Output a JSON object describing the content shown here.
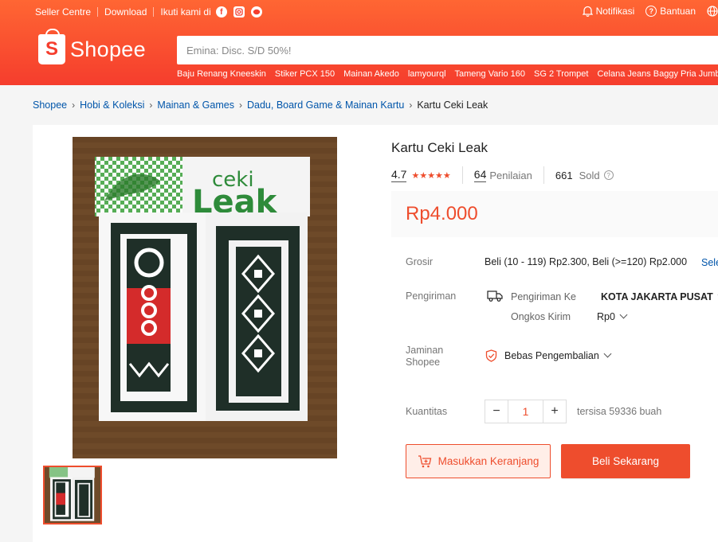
{
  "topbar": {
    "seller_centre": "Seller Centre",
    "download": "Download",
    "follow": "Ikuti kami di",
    "notifications": "Notifikasi",
    "help": "Bantuan"
  },
  "brand": {
    "name": "Shopee",
    "logo_letter": "S"
  },
  "search": {
    "placeholder": "Emina: Disc. S/D 50%!"
  },
  "suggestions": [
    "Baju Renang Kneeskin",
    "Stiker PCX 150",
    "Mainan Akedo",
    "lamyourql",
    "Tameng Vario 160",
    "SG 2 Trompet",
    "Celana Jeans Baggy Pria Jumbo"
  ],
  "breadcrumb": {
    "items": [
      "Shopee",
      "Hobi & Koleksi",
      "Mainan & Games",
      "Dadu, Board Game & Mainan Kartu"
    ],
    "current": "Kartu Ceki Leak"
  },
  "product": {
    "title": "Kartu Ceki Leak",
    "rating": "4.7",
    "stars": "★★★★★",
    "reviews_count": "64",
    "reviews_label": "Penilaian",
    "sold_count": "661",
    "sold_label": "Sold",
    "price": "Rp4.000",
    "box_brand_small": "ceki",
    "box_brand_large": "Leak"
  },
  "details": {
    "wholesale_label": "Grosir",
    "wholesale_value": "Beli (10 - 119) Rp2.300, Beli (>=120) Rp2.000",
    "wholesale_link": "Sele",
    "shipping_label": "Pengiriman",
    "ship_to_label": "Pengiriman Ke",
    "ship_to_value": "KOTA JAKARTA PUSAT",
    "ship_cost_label": "Ongkos Kirim",
    "ship_cost_value": "Rp0",
    "guarantee_label_1": "Jaminan",
    "guarantee_label_2": "Shopee",
    "guarantee_value": "Bebas Pengembalian",
    "quantity_label": "Kuantitas",
    "quantity_value": "1",
    "quantity_minus": "−",
    "quantity_plus": "+",
    "stock_text": "tersisa 59336 buah"
  },
  "actions": {
    "add_to_cart": "Masukkan Keranjang",
    "buy_now": "Beli Sekarang"
  },
  "colors": {
    "brand": "#ee4d2d",
    "header": "#f53d2d",
    "link": "#0055aa"
  },
  "icons": [
    "facebook-icon",
    "instagram-icon",
    "line-icon",
    "bell-icon",
    "help-icon",
    "globe-icon",
    "truck-icon",
    "shield-icon",
    "cart-plus-icon"
  ]
}
